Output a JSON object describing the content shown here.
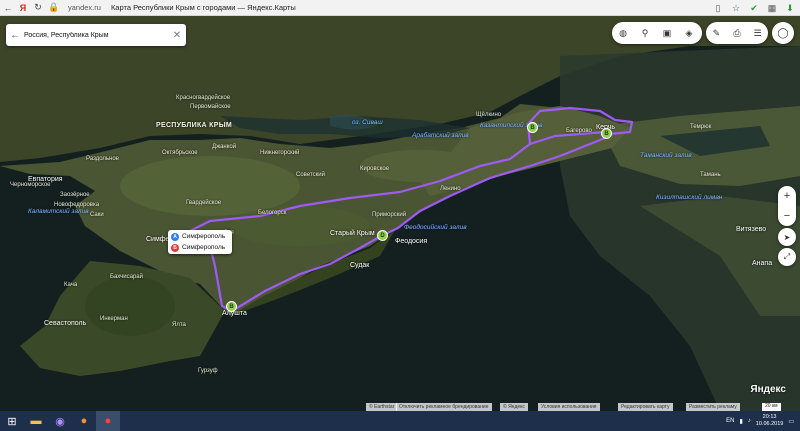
{
  "browser": {
    "yandex_logo": "Я",
    "url": "yandex.ru",
    "title": "Карта Республики Крым с городами — Яндекс.Карты"
  },
  "search": {
    "value": "Россия, Республика Крым"
  },
  "route": {
    "points": [
      "Симферополь",
      "Симферополь"
    ],
    "point_letters": [
      "A",
      "Б"
    ],
    "waypoint_marker_letters": [
      "B",
      "B",
      "D",
      "B"
    ],
    "color": "#a35cff"
  },
  "map_labels": {
    "region": "РЕСПУБЛИКА КРЫМ",
    "water": [
      "оз. Сиваш",
      "Арабатский залив",
      "Каламитский залив",
      "Феодосийский залив",
      "Казантипский залив",
      "Таманский залив",
      "Кизилташский лиман"
    ],
    "cities": [
      "Евпатория",
      "Симферополь",
      "Севастополь",
      "Феодосия",
      "Алушта",
      "Старый Крым",
      "Судак",
      "Керчь",
      "Анапа",
      "Витязево"
    ],
    "settlements": [
      "Красногвардейское",
      "Первомайское",
      "Октябрьское",
      "Раздольное",
      "Черноморское",
      "Саки",
      "Новофедоровка",
      "Бахчисарай",
      "Белогорск",
      "Кировское",
      "Ленино",
      "Щёлкино",
      "Багерово",
      "Кача",
      "Инкерман",
      "Ялта",
      "Гурзуф",
      "Тамань",
      "Темрюк",
      "Джанкой",
      "Нижнегорский",
      "Советский",
      "Заозёрное",
      "Гвардейское",
      "Зуя",
      "Приморский"
    ]
  },
  "branding": {
    "logo": "Яндекс",
    "attribution": [
      "© Earthstar",
      "Отключить рекламное брендирование",
      "© Яндекс",
      "Условия использования",
      "Редактировать карту",
      "Разместить рекламу"
    ],
    "scale": "20 км"
  },
  "taskbar": {
    "lang": "EN",
    "time": "20:13",
    "date": "10.06.2019"
  },
  "colors": {
    "land": "#3d4a2c",
    "sea": "#152424",
    "route": "#a35cff",
    "marker": "#8fd14f"
  }
}
